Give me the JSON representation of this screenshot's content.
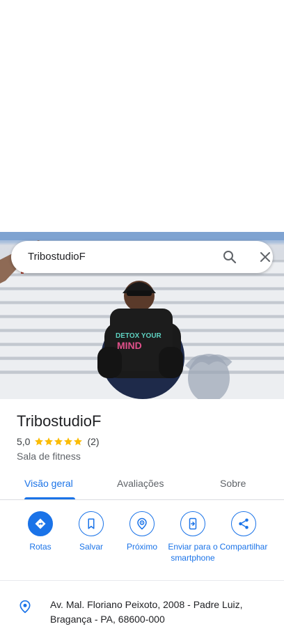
{
  "search": {
    "query": "TribostudioF"
  },
  "place": {
    "name": "TribostudioF",
    "rating": "5,0",
    "review_count": "(2)",
    "stars": 5,
    "category": "Sala de fitness",
    "photo_text": "DETOX YOUR MIND"
  },
  "tabs": [
    {
      "label": "Visão geral",
      "active": true
    },
    {
      "label": "Avaliações",
      "active": false
    },
    {
      "label": "Sobre",
      "active": false
    }
  ],
  "actions": [
    {
      "label": "Rotas",
      "icon": "directions-icon"
    },
    {
      "label": "Salvar",
      "icon": "bookmark-icon"
    },
    {
      "label": "Próximo",
      "icon": "nearby-icon"
    },
    {
      "label": "Enviar para o smartphone",
      "icon": "send-to-phone-icon"
    },
    {
      "label": "Compartilhar",
      "icon": "share-icon"
    }
  ],
  "address": {
    "text": "Av. Mal. Floriano Peixoto, 2008 - Padre Luiz, Bragança - PA, 68600-000",
    "icon": "location-pin-icon"
  },
  "colors": {
    "accent": "#1a73e8",
    "star": "#fbbc04"
  }
}
